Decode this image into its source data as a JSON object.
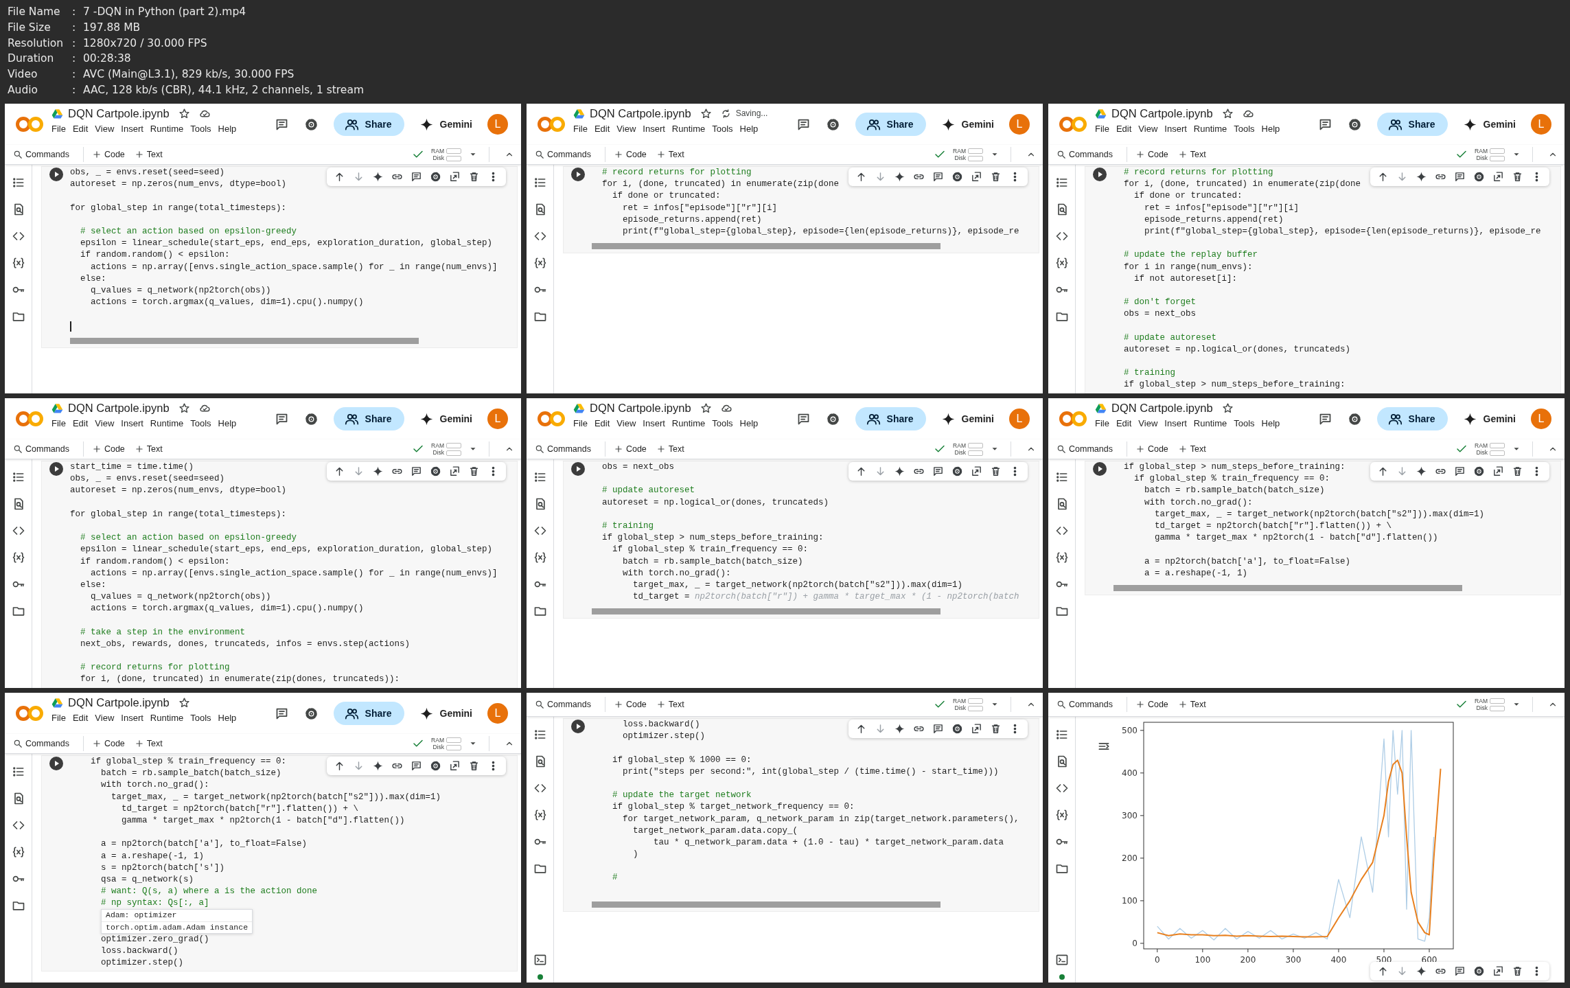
{
  "file_info": [
    {
      "label": "File Name",
      "separator": ":",
      "value": "7 -DQN in Python (part 2).mp4"
    },
    {
      "label": "File Size",
      "separator": ":",
      "value": "197.88 MB"
    },
    {
      "label": "Resolution",
      "separator": ":",
      "value": "1280x720 / 30.000 FPS"
    },
    {
      "label": "Duration",
      "separator": ":",
      "value": "00:28:38"
    },
    {
      "label": "Video",
      "separator": ":",
      "value": "AVC (Main@L3.1), 829 kb/s, 30.000 FPS"
    },
    {
      "label": "Audio",
      "separator": ":",
      "value": "AAC, 128 kb/s (CBR), 44.1 kHz, 2 channels, 1 stream"
    }
  ],
  "panels": [
    {
      "header": {
        "title": "DQN Cartpole.ipynb",
        "cloud": true,
        "menu": [
          "File",
          "Edit",
          "View",
          "Insert",
          "Runtime",
          "Tools",
          "Help"
        ],
        "share": "Share",
        "gemini": "Gemini",
        "avatar": "L"
      },
      "toolbar": {
        "commands": "Commands",
        "add_code": "Code",
        "add_text": "Text",
        "ram": "RAM",
        "disk": "Disk"
      },
      "sidebar": {
        "terminal": false
      },
      "cell": {
        "end_visible": true,
        "lines": [
          {
            "kind": "code",
            "text": "obs, _ = envs.reset(seed=seed)"
          },
          {
            "kind": "code",
            "text": "autoreset = np.zeros(num_envs, dtype=bool)"
          },
          {
            "kind": "blank"
          },
          {
            "kind": "code",
            "text": "for global_step in range(total_timesteps):"
          },
          {
            "kind": "blank"
          },
          {
            "kind": "comment",
            "text": "  # select an action based on epsilon-greedy"
          },
          {
            "kind": "code",
            "text": "  epsilon = linear_schedule(start_eps, end_eps, exploration_duration, global_step)"
          },
          {
            "kind": "code",
            "text": "  if random.random() < epsilon:"
          },
          {
            "kind": "code",
            "text": "    actions = np.array([envs.single_action_space.sample() for _ in range(num_envs)]"
          },
          {
            "kind": "code",
            "text": "  else:"
          },
          {
            "kind": "code",
            "text": "    q_values = q_network(np2torch(obs))"
          },
          {
            "kind": "code",
            "text": "    actions = torch.argmax(q_values, dim=1).cpu().numpy()"
          },
          {
            "kind": "blank"
          },
          {
            "kind": "cursor"
          }
        ]
      }
    },
    {
      "header": {
        "title": "DQN Cartpole.ipynb",
        "cloud": false,
        "saving": "Saving...",
        "menu": [
          "File",
          "Edit",
          "View",
          "Insert",
          "Runtime",
          "Tools",
          "Help"
        ],
        "share": "Share",
        "gemini": "Gemini",
        "avatar": "L"
      },
      "toolbar": {
        "commands": "Commands",
        "add_code": "Code",
        "add_text": "Text",
        "ram": "RAM",
        "disk": "Disk"
      },
      "sidebar": {
        "terminal": false
      },
      "cell": {
        "end_visible": true,
        "lines": [
          {
            "kind": "comment",
            "text": "  # record returns for plotting"
          },
          {
            "kind": "code",
            "text": "  for i, (done, truncated) in enumerate(zip(done"
          },
          {
            "kind": "code",
            "text": "    if done or truncated:"
          },
          {
            "kind": "code",
            "text": "      ret = infos[\"episode\"][\"r\"][i]"
          },
          {
            "kind": "code",
            "text": "      episode_returns.append(ret)"
          },
          {
            "kind": "code",
            "text": "      print(f\"global_step={global_step}, episode={len(episode_returns)}, episode_re"
          }
        ]
      }
    },
    {
      "header": {
        "title": "DQN Cartpole.ipynb",
        "cloud": true,
        "menu": [
          "File",
          "Edit",
          "View",
          "Insert",
          "Runtime",
          "Tools",
          "Help"
        ],
        "share": "Share",
        "gemini": "Gemini",
        "avatar": "L"
      },
      "toolbar": {
        "commands": "Commands",
        "add_code": "Code",
        "add_text": "Text",
        "ram": "RAM",
        "disk": "Disk"
      },
      "sidebar": {
        "terminal": false
      },
      "cell": {
        "end_visible": false,
        "lines": [
          {
            "kind": "comment",
            "text": "  # record returns for plotting"
          },
          {
            "kind": "code",
            "text": "  for i, (done, truncated) in enumerate(zip(done"
          },
          {
            "kind": "code",
            "text": "    if done or truncated:"
          },
          {
            "kind": "code",
            "text": "      ret = infos[\"episode\"][\"r\"][i]"
          },
          {
            "kind": "code",
            "text": "      episode_returns.append(ret)"
          },
          {
            "kind": "code",
            "text": "      print(f\"global_step={global_step}, episode={len(episode_returns)}, episode_re"
          },
          {
            "kind": "blank"
          },
          {
            "kind": "comment",
            "text": "  # update the replay buffer"
          },
          {
            "kind": "code",
            "text": "  for i in range(num_envs):"
          },
          {
            "kind": "code",
            "text": "    if not autoreset[i]:"
          },
          {
            "kind": "blank"
          },
          {
            "kind": "comment",
            "text": "  # don't forget"
          },
          {
            "kind": "code",
            "text": "  obs = next_obs"
          },
          {
            "kind": "blank"
          },
          {
            "kind": "comment",
            "text": "  # update autoreset"
          },
          {
            "kind": "code",
            "text": "  autoreset = np.logical_or(dones, truncateds)"
          },
          {
            "kind": "blank"
          },
          {
            "kind": "comment",
            "text": "  # training"
          },
          {
            "kind": "code",
            "text": "  if global_step > num_steps_before_training:"
          }
        ]
      }
    },
    {
      "header": {
        "title": "DQN Cartpole.ipynb",
        "cloud": true,
        "menu": [
          "File",
          "Edit",
          "View",
          "Insert",
          "Runtime",
          "Tools",
          "Help"
        ],
        "share": "Share",
        "gemini": "Gemini",
        "avatar": "L"
      },
      "toolbar": {
        "commands": "Commands",
        "add_code": "Code",
        "add_text": "Text",
        "ram": "RAM",
        "disk": "Disk"
      },
      "sidebar": {
        "terminal": false
      },
      "cell": {
        "end_visible": false,
        "lines": [
          {
            "kind": "code",
            "text": "start_time = time.time()"
          },
          {
            "kind": "code",
            "text": "obs, _ = envs.reset(seed=seed)"
          },
          {
            "kind": "code",
            "text": "autoreset = np.zeros(num_envs, dtype=bool)"
          },
          {
            "kind": "blank"
          },
          {
            "kind": "code",
            "text": "for global_step in range(total_timesteps):"
          },
          {
            "kind": "blank"
          },
          {
            "kind": "comment",
            "text": "  # select an action based on epsilon-greedy"
          },
          {
            "kind": "code",
            "text": "  epsilon = linear_schedule(start_eps, end_eps, exploration_duration, global_step)"
          },
          {
            "kind": "code",
            "text": "  if random.random() < epsilon:"
          },
          {
            "kind": "code",
            "text": "    actions = np.array([envs.single_action_space.sample() for _ in range(num_envs)]"
          },
          {
            "kind": "code",
            "text": "  else:"
          },
          {
            "kind": "code",
            "text": "    q_values = q_network(np2torch(obs))"
          },
          {
            "kind": "code",
            "text": "    actions = torch.argmax(q_values, dim=1).cpu().numpy()"
          },
          {
            "kind": "blank"
          },
          {
            "kind": "comment",
            "text": "  # take a step in the environment"
          },
          {
            "kind": "code",
            "text": "  next_obs, rewards, dones, truncateds, infos = envs.step(actions)"
          },
          {
            "kind": "blank"
          },
          {
            "kind": "comment",
            "text": "  # record returns for plotting"
          },
          {
            "kind": "code",
            "text": "  for i, (done, truncated) in enumerate(zip(dones, truncateds)):"
          }
        ]
      }
    },
    {
      "header": {
        "title": "DQN Cartpole.ipynb",
        "cloud": true,
        "menu": [
          "File",
          "Edit",
          "View",
          "Insert",
          "Runtime",
          "Tools",
          "Help"
        ],
        "share": "Share",
        "gemini": "Gemini",
        "avatar": "L"
      },
      "toolbar": {
        "commands": "Commands",
        "add_code": "Code",
        "add_text": "Text",
        "ram": "RAM",
        "disk": "Disk"
      },
      "sidebar": {
        "terminal": false
      },
      "cell": {
        "end_visible": true,
        "lines": [
          {
            "kind": "code",
            "text": "  obs = next_obs"
          },
          {
            "kind": "blank"
          },
          {
            "kind": "comment",
            "text": "  # update autoreset"
          },
          {
            "kind": "code",
            "text": "  autoreset = np.logical_or(dones, truncateds)"
          },
          {
            "kind": "blank"
          },
          {
            "kind": "comment",
            "text": "  # training"
          },
          {
            "kind": "code",
            "text": "  if global_step > num_steps_before_training:"
          },
          {
            "kind": "code",
            "text": "    if global_step % train_frequency == 0:"
          },
          {
            "kind": "code",
            "text": "      batch = rb.sample_batch(batch_size)"
          },
          {
            "kind": "code",
            "text": "      with torch.no_grad():"
          },
          {
            "kind": "code",
            "text": "        target_max, _ = target_network(np2torch(batch[\"s2\"])).max(dim=1)"
          },
          {
            "kind": "code",
            "text": "        td_target = ",
            "ghost": "np2torch(batch[\"r\"]) + gamma * target_max * (1 - np2torch(batch"
          }
        ]
      }
    },
    {
      "header": {
        "title": "DQN Cartpole.ipynb",
        "cloud": false,
        "menu": [
          "File",
          "Edit",
          "View",
          "Insert",
          "Runtime",
          "Tools",
          "Help"
        ],
        "share": "Share",
        "gemini": "Gemini",
        "avatar": "L"
      },
      "toolbar": {
        "commands": "Commands",
        "add_code": "Code",
        "add_text": "Text",
        "ram": "RAM",
        "disk": "Disk"
      },
      "sidebar": {
        "terminal": false
      },
      "cell": {
        "end_visible": true,
        "lines": [
          {
            "kind": "code",
            "text": "  if global_step > num_steps_before_training:"
          },
          {
            "kind": "code",
            "text": "    if global_step % train_frequency == 0:"
          },
          {
            "kind": "code",
            "text": "      batch = rb.sample_batch(batch_size)"
          },
          {
            "kind": "code",
            "text": "      with torch.no_grad():"
          },
          {
            "kind": "code",
            "text": "        target_max, _ = target_network(np2torch(batch[\"s2\"])).max(dim=1)"
          },
          {
            "kind": "code",
            "text": "        td_target = np2torch(batch[\"r\"].flatten()) + \\"
          },
          {
            "kind": "code",
            "text": "        gamma * target_max * np2torch(1 - batch[\"d\"].flatten())"
          },
          {
            "kind": "blank"
          },
          {
            "kind": "code",
            "text": "      a = np2torch(batch['a'], to_float=False)"
          },
          {
            "kind": "code",
            "text": "      a = a.reshape(-1, 1)"
          }
        ]
      }
    },
    {
      "header": {
        "title": "DQN Cartpole.ipynb",
        "cloud": false,
        "menu": [
          "File",
          "Edit",
          "View",
          "Insert",
          "Runtime",
          "Tools",
          "Help"
        ],
        "share": "Share",
        "gemini": "Gemini",
        "avatar": "L"
      },
      "toolbar": {
        "commands": "Commands",
        "add_code": "Code",
        "add_text": "Text",
        "ram": "RAM",
        "disk": "Disk"
      },
      "sidebar": {
        "terminal": false
      },
      "cell": {
        "end_visible": false,
        "lines": [
          {
            "kind": "code",
            "text": "    if global_step % train_frequency == 0:"
          },
          {
            "kind": "code",
            "text": "      batch = rb.sample_batch(batch_size)"
          },
          {
            "kind": "code",
            "text": "      with torch.no_grad():"
          },
          {
            "kind": "code",
            "text": "        target_max, _ = target_network(np2torch(batch[\"s2\"])).max(dim=1)"
          },
          {
            "kind": "code",
            "text": "          td_target = np2torch(batch[\"r\"].flatten()) + \\"
          },
          {
            "kind": "code",
            "text": "          gamma * target_max * np2torch(1 - batch[\"d\"].flatten())"
          },
          {
            "kind": "blank"
          },
          {
            "kind": "code",
            "text": "      a = np2torch(batch['a'], to_float=False)"
          },
          {
            "kind": "code",
            "text": "      a = a.reshape(-1, 1)"
          },
          {
            "kind": "code",
            "text": "      s = np2torch(batch['s'])"
          },
          {
            "kind": "code",
            "text": "      qsa = q_network(s)"
          },
          {
            "kind": "comment",
            "text": "      # want: Q(s, a) where a is the action done"
          },
          {
            "kind": "comment",
            "text": "      # np syntax: Qs[:, a]"
          },
          {
            "kind": "popup",
            "items": [
              "Adam: optimizer",
              "torch.optim.adam.Adam instance"
            ]
          },
          {
            "kind": "code",
            "text": "      optimizer.zero_grad()"
          },
          {
            "kind": "code",
            "text": "      loss.backward()"
          },
          {
            "kind": "code",
            "text": "      optimizer.step()"
          }
        ]
      }
    },
    {
      "toolbar": {
        "commands": "Commands",
        "add_code": "Code",
        "add_text": "Text",
        "ram": "RAM",
        "disk": "Disk"
      },
      "sidebar": {
        "terminal": true
      },
      "cell": {
        "end_visible": true,
        "lines": [
          {
            "kind": "code",
            "text": "      loss.backward()"
          },
          {
            "kind": "code",
            "text": "      optimizer.step()"
          },
          {
            "kind": "blank"
          },
          {
            "kind": "code",
            "text": "    if global_step % 1000 == 0:"
          },
          {
            "kind": "code",
            "text": "      print(\"steps per second:\", int(global_step / (time.time() - start_time)))"
          },
          {
            "kind": "blank"
          },
          {
            "kind": "comment",
            "text": "    # update the target network"
          },
          {
            "kind": "code",
            "text": "    if global_step % target_network_frequency == 0:"
          },
          {
            "kind": "code",
            "text": "      for target_network_param, q_network_param in zip(target_network.parameters(),"
          },
          {
            "kind": "code",
            "text": "        target_network_param.data.copy_("
          },
          {
            "kind": "code",
            "text": "            tau * q_network_param.data + (1.0 - tau) * target_network_param.data"
          },
          {
            "kind": "code",
            "text": "        )"
          },
          {
            "kind": "blank"
          },
          {
            "kind": "comment",
            "text": "    #"
          },
          {
            "kind": "blank"
          }
        ]
      }
    },
    {
      "toolbar": {
        "commands": "Commands",
        "add_code": "Code",
        "add_text": "Text",
        "ram": "RAM",
        "disk": "Disk"
      },
      "sidebar": {
        "terminal": true
      },
      "output": {
        "chart_data": {
          "type": "line",
          "x": [
            0,
            25,
            50,
            75,
            100,
            125,
            150,
            175,
            200,
            225,
            250,
            275,
            300,
            325,
            350,
            375,
            400,
            425,
            450,
            475,
            500,
            510,
            520,
            530,
            540,
            550,
            560,
            575,
            590,
            600,
            610,
            625
          ],
          "series": [
            {
              "color": "#aecde6",
              "values": [
                40,
                10,
                35,
                12,
                30,
                8,
                35,
                10,
                28,
                12,
                30,
                10,
                22,
                12,
                25,
                10,
                150,
                60,
                250,
                120,
                480,
                250,
                500,
                350,
                500,
                80,
                500,
                10,
                5,
                60,
                250,
                null
              ]
            },
            {
              "color": "#e8801f",
              "values": [
                25,
                18,
                22,
                20,
                20,
                18,
                19,
                17,
                18,
                17,
                16,
                17,
                16,
                15,
                15,
                16,
                60,
                100,
                150,
                190,
                300,
                380,
                420,
                430,
                400,
                250,
                120,
                50,
                25,
                20,
                200,
                410
              ]
            }
          ],
          "xlim": [
            -30,
            653
          ],
          "ylim": [
            -13,
            519
          ],
          "xticks": [
            0,
            100,
            200,
            300,
            400,
            500,
            600
          ],
          "yticks": [
            0,
            100,
            200,
            300,
            400,
            500
          ]
        }
      }
    }
  ]
}
